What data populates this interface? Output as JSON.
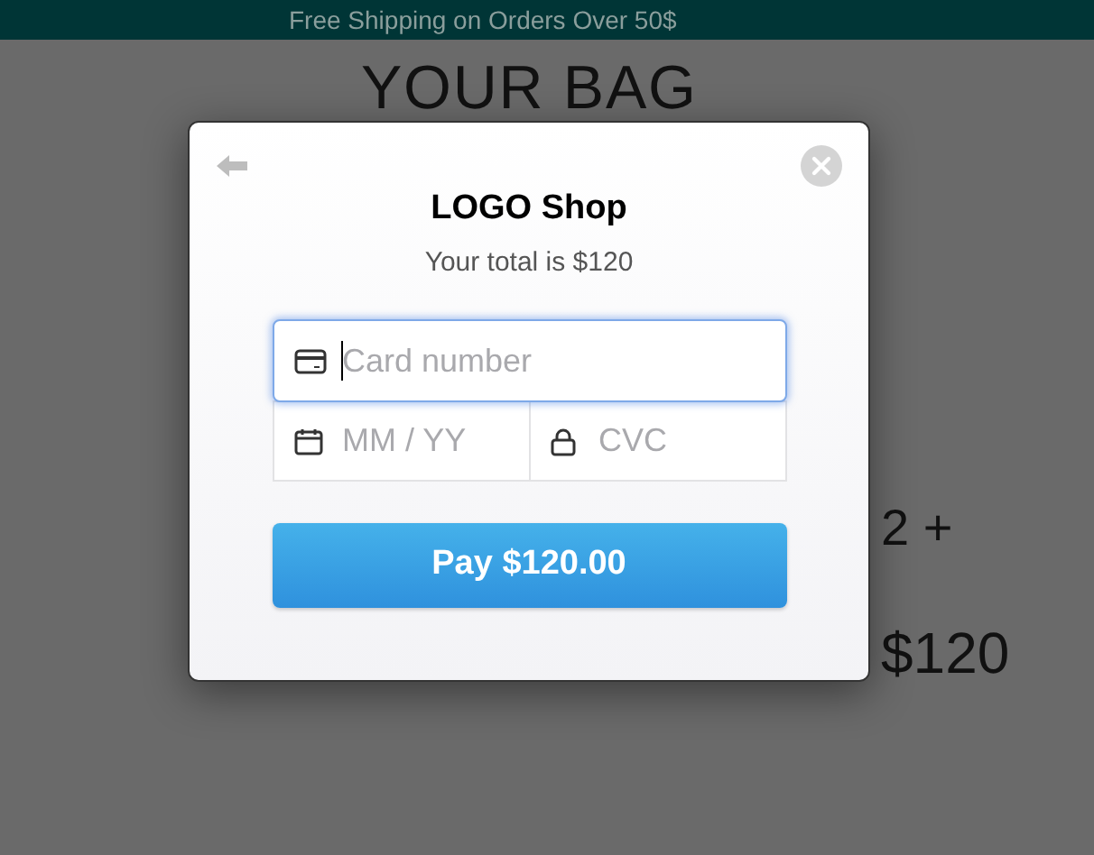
{
  "banner": {
    "text": "Free Shipping on Orders Over 50$"
  },
  "page": {
    "title": "YOUR BAG",
    "quantity": "2 +",
    "total": "$120"
  },
  "modal": {
    "title": "LOGO Shop",
    "subtitle": "Your total is $120",
    "fields": [
      {
        "kind": "card",
        "placeholder": "Card number",
        "focused": true
      },
      {
        "kind": "expiry",
        "placeholder": "MM / YY",
        "focused": false
      },
      {
        "kind": "cvc",
        "placeholder": "CVC",
        "focused": false
      }
    ],
    "pay_button": "Pay $120.00"
  }
}
